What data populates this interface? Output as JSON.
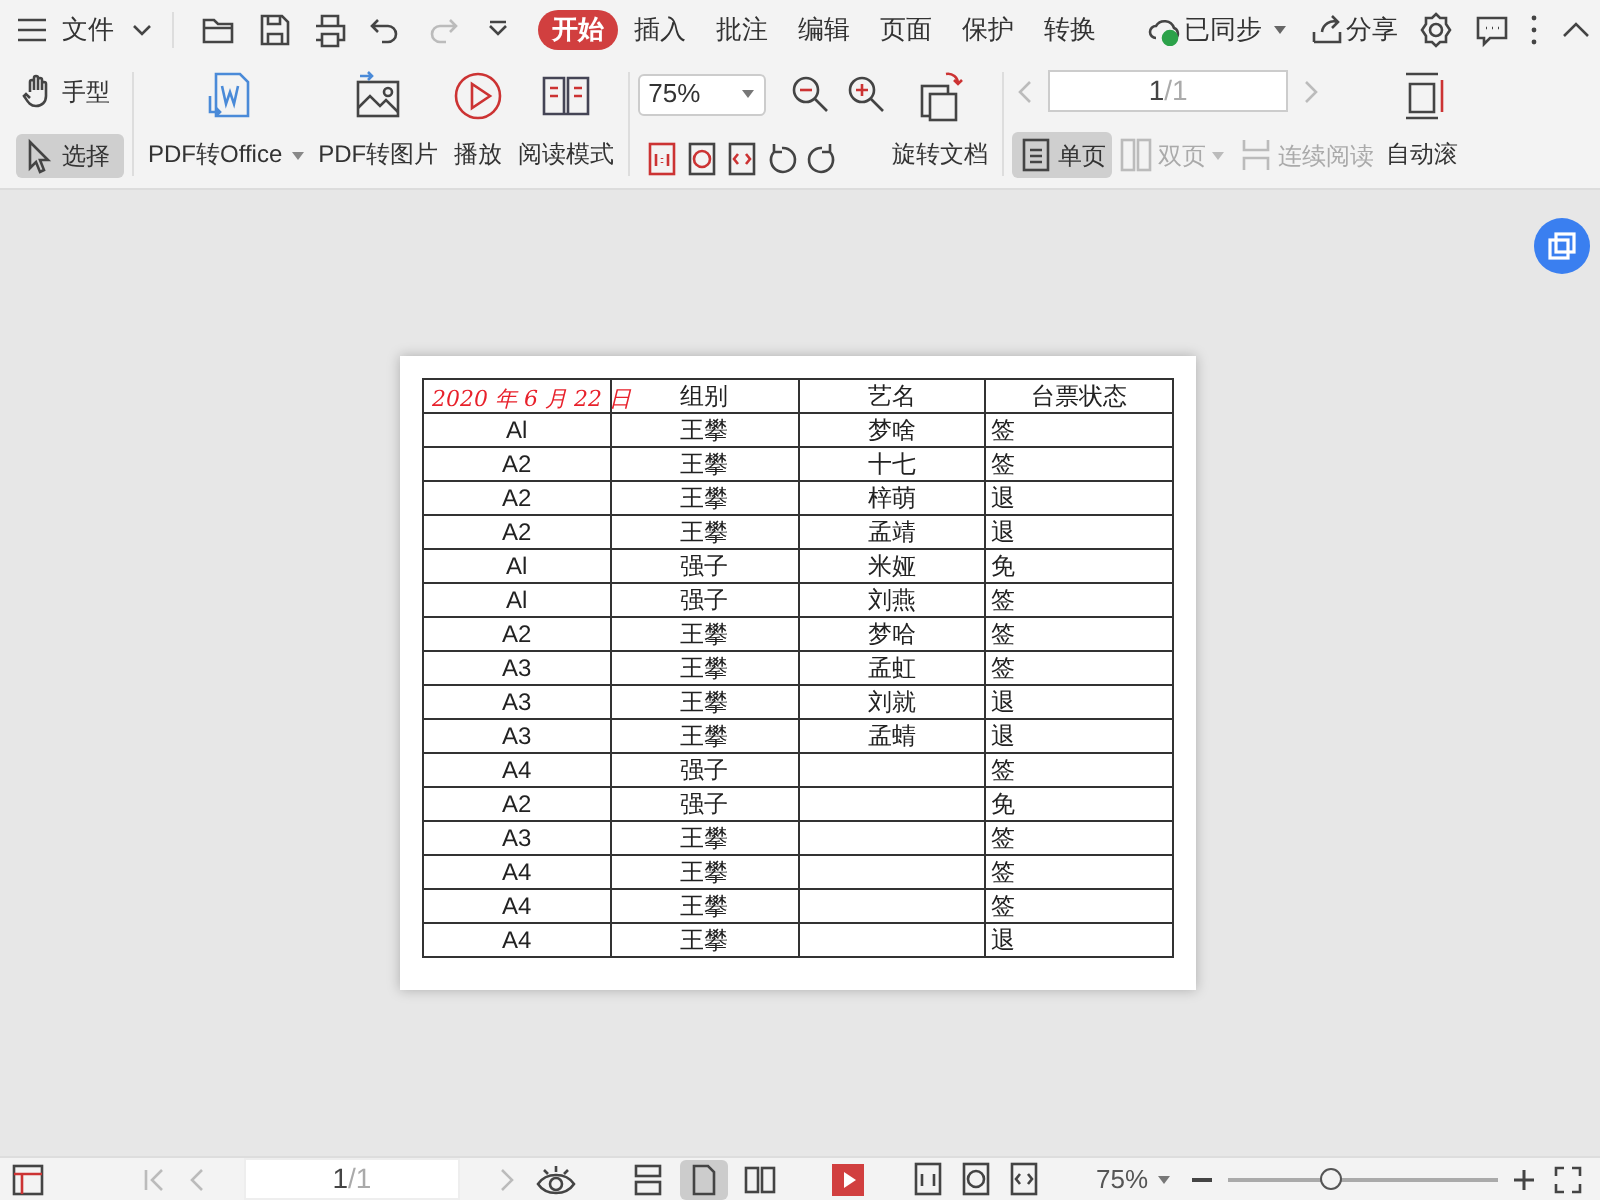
{
  "menu_bar": {
    "file_menu": "文件",
    "tabs": [
      {
        "label": "开始",
        "selected": true
      },
      {
        "label": "插入",
        "selected": false
      },
      {
        "label": "批注",
        "selected": false
      },
      {
        "label": "编辑",
        "selected": false
      },
      {
        "label": "页面",
        "selected": false
      },
      {
        "label": "保护",
        "selected": false
      },
      {
        "label": "转换",
        "selected": false
      }
    ],
    "sync": "已同步",
    "share": "分享"
  },
  "ribbon": {
    "tools": [
      {
        "label": "手型",
        "selected": false
      },
      {
        "label": "选择",
        "selected": true
      }
    ],
    "big_buttons": [
      {
        "label": "PDF转Office",
        "kind": "pdf-office"
      },
      {
        "label": "PDF转图片",
        "kind": "pdf-image"
      },
      {
        "label": "播放",
        "kind": "play"
      },
      {
        "label": "阅读模式",
        "kind": "read"
      }
    ],
    "zoom": "75%",
    "rotate": "旋转文档",
    "page_current": "1",
    "page_total": "/1",
    "views": [
      {
        "label": "单页",
        "selected": true,
        "disabled": false
      },
      {
        "label": "双页",
        "selected": false,
        "disabled": true
      },
      {
        "label": "连续阅读",
        "selected": false,
        "disabled": true
      }
    ],
    "auto_scroll": "自动滚"
  },
  "document": {
    "columns": [
      "2020 年 6 月 22 日",
      "组别",
      "艺名",
      "台票状态"
    ],
    "rows": [
      [
        "Al",
        "王攀",
        "梦啥",
        "签"
      ],
      [
        "A2",
        "王攀",
        "十七",
        "签"
      ],
      [
        "A2",
        "王攀",
        "梓萌",
        "退"
      ],
      [
        "A2",
        "王攀",
        "孟靖",
        "退"
      ],
      [
        "Al",
        "强子",
        "米娅",
        "免"
      ],
      [
        "Al",
        "强子",
        "刘燕",
        "签"
      ],
      [
        "A2",
        "王攀",
        "梦哈",
        "签"
      ],
      [
        "A3",
        "王攀",
        "孟虹",
        "签"
      ],
      [
        "A3",
        "王攀",
        "刘就",
        "退"
      ],
      [
        "A3",
        "王攀",
        "孟蜻",
        "退"
      ],
      [
        "A4",
        "强子",
        "",
        "签"
      ],
      [
        "A2",
        "强子",
        "",
        "免"
      ],
      [
        "A3",
        "王攀",
        "",
        "签"
      ],
      [
        "A4",
        "王攀",
        "",
        "签"
      ],
      [
        "A4",
        "王攀",
        "",
        "签"
      ],
      [
        "A4",
        "王攀",
        "",
        "退"
      ]
    ]
  },
  "status_bar": {
    "page_current": "1",
    "page_total": "/1",
    "views": [
      {
        "selected": false
      },
      {
        "selected": true
      },
      {
        "selected": false
      }
    ],
    "zoom": "75%",
    "zoom_slider": {
      "level": 0.38
    }
  }
}
